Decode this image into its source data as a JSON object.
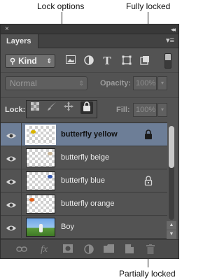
{
  "callouts": {
    "lock_options": "Lock options",
    "fully_locked": "Fully locked",
    "partially_locked": "Partially locked"
  },
  "panel": {
    "close_glyph": "×",
    "collapse_glyph": "◂◂",
    "tab_label": "Layers",
    "menu_glyph": "▾≡"
  },
  "filter": {
    "kind_label": "Kind",
    "kind_icon": "search-icon",
    "icons": [
      "image-filter-icon",
      "adjustment-filter-icon",
      "type-filter-icon",
      "shape-filter-icon",
      "smart-object-filter-icon"
    ]
  },
  "blend": {
    "mode": "Normal",
    "opacity_label": "Opacity:",
    "opacity_value": "100%",
    "fill_label": "Fill:",
    "fill_value": "100%"
  },
  "lock": {
    "label": "Lock:",
    "icons": [
      "lock-transparent-pixels-icon",
      "lock-image-pixels-icon",
      "lock-position-icon",
      "lock-all-icon"
    ],
    "selected": "lock-all-icon"
  },
  "layers": [
    {
      "name": "butterfly yellow",
      "selected": true,
      "lock": "full",
      "thumb_accent": "#d9b400"
    },
    {
      "name": "butterfly beige",
      "selected": false,
      "lock": "none",
      "thumb_accent": "#c9b596"
    },
    {
      "name": "butterfly blue",
      "selected": false,
      "lock": "partial",
      "thumb_accent": "#3355aa"
    },
    {
      "name": "butterfly orange",
      "selected": false,
      "lock": "none",
      "thumb_accent": "#e0601a"
    },
    {
      "name": "Boy",
      "selected": false,
      "lock": "none",
      "thumb_accent": "#5a9a3a"
    }
  ],
  "bottom_icons": [
    "link-layers-icon",
    "layer-effects-icon",
    "add-mask-icon",
    "adjustment-layer-icon",
    "new-group-icon",
    "new-layer-icon",
    "delete-layer-icon"
  ],
  "colors": {
    "panel_bg": "#535353",
    "selected_row": "#6d7e97"
  }
}
